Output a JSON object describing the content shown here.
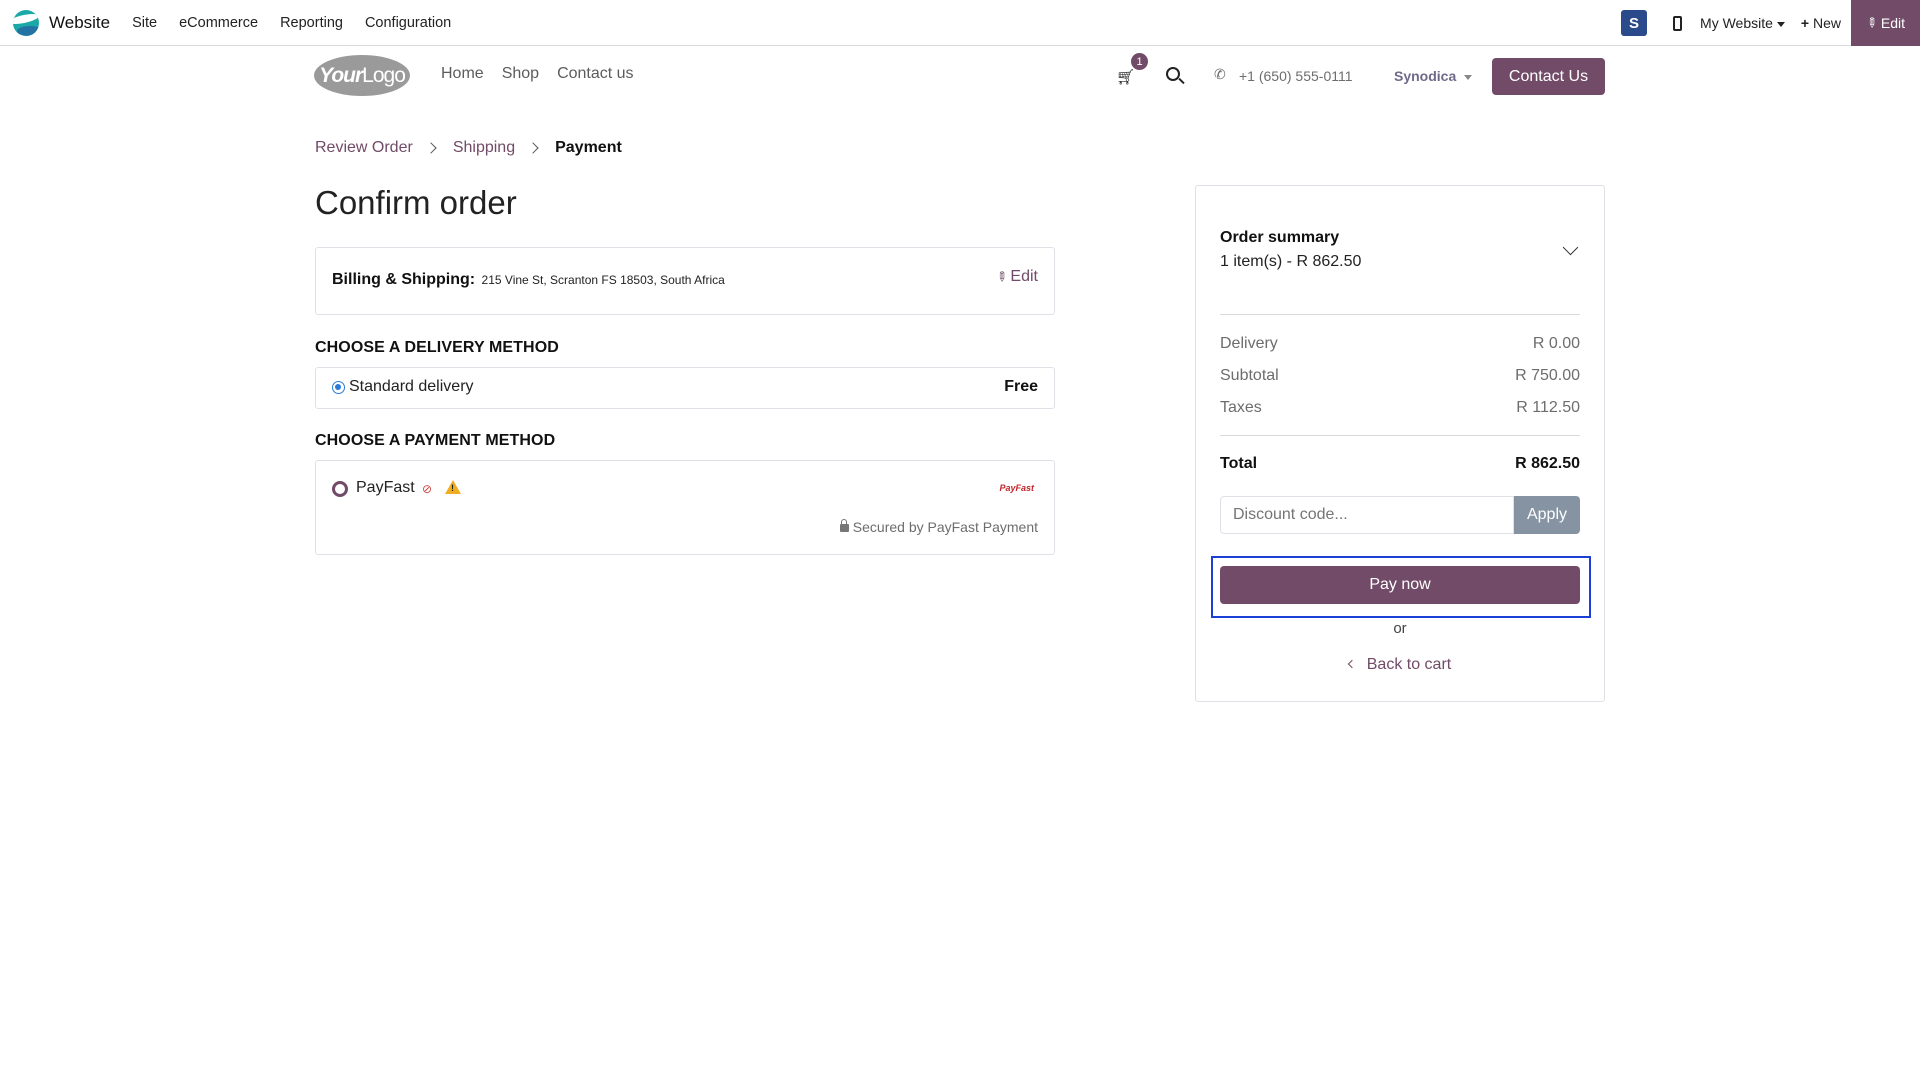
{
  "admin": {
    "app_name": "Website",
    "menu": [
      "Site",
      "eCommerce",
      "Reporting",
      "Configuration"
    ],
    "website_selector": "My Website",
    "new_label": "New",
    "edit_label": "Edit"
  },
  "header": {
    "logo_text_bold": "Your",
    "logo_text": "Logo",
    "nav": [
      "Home",
      "Shop",
      "Contact us"
    ],
    "cart_count": "1",
    "phone": "+1 (650) 555-0111",
    "company": "Synodica",
    "contact_button": "Contact Us"
  },
  "breadcrumb": {
    "step1": "Review Order",
    "step2": "Shipping",
    "step3": "Payment"
  },
  "page_title": "Confirm order",
  "billing": {
    "label": "Billing & Shipping:",
    "address": "215 Vine St, Scranton FS 18503, South Africa",
    "edit": "Edit"
  },
  "delivery": {
    "heading": "CHOOSE A DELIVERY METHOD",
    "name": "Standard delivery",
    "price": "Free"
  },
  "payment": {
    "heading": "CHOOSE A PAYMENT METHOD",
    "name": "PayFast",
    "logo_text": "PayFast",
    "secured": "Secured by PayFast Payment"
  },
  "summary": {
    "title": "Order summary",
    "items": "1 item(s) -  R 862.50",
    "delivery_label": "Delivery",
    "delivery_value": "R 0.00",
    "subtotal_label": "Subtotal",
    "subtotal_value": "R 750.00",
    "taxes_label": "Taxes",
    "taxes_value": "R 112.50",
    "total_label": "Total",
    "total_value": "R 862.50",
    "discount_placeholder": "Discount code...",
    "apply": "Apply",
    "pay_now": "Pay now",
    "or": "or",
    "back_to_cart": "Back to cart"
  },
  "colors": {
    "brand": "#714b67",
    "focus": "#1c3fd6",
    "apply": "#8593a3"
  }
}
